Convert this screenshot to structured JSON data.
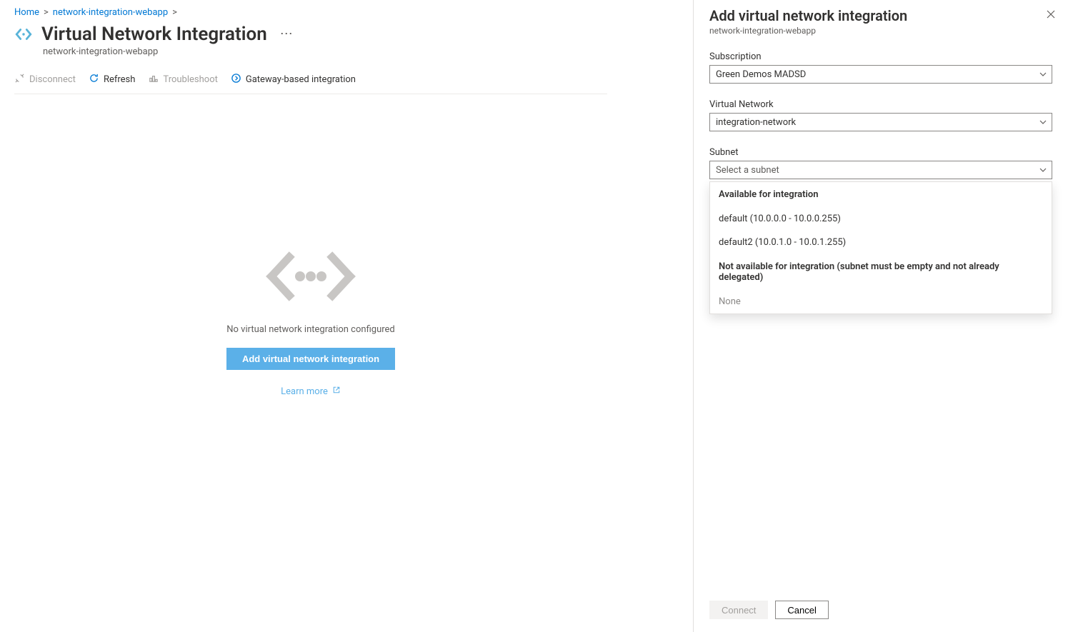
{
  "breadcrumb": {
    "home": "Home",
    "resource": "network-integration-webapp"
  },
  "header": {
    "title": "Virtual Network Integration",
    "subtitle": "network-integration-webapp"
  },
  "toolbar": {
    "disconnect": "Disconnect",
    "refresh": "Refresh",
    "troubleshoot": "Troubleshoot",
    "gateway": "Gateway-based integration"
  },
  "empty": {
    "message": "No virtual network integration configured",
    "button": "Add virtual network integration",
    "learn_more": "Learn more"
  },
  "panel": {
    "title": "Add virtual network integration",
    "subtitle": "network-integration-webapp",
    "subscription": {
      "label": "Subscription",
      "value": "Green Demos MADSD"
    },
    "vnet": {
      "label": "Virtual Network",
      "value": "integration-network"
    },
    "subnet": {
      "label": "Subnet",
      "placeholder": "Select a subnet",
      "available_header": "Available for integration",
      "options": [
        "default (10.0.0.0 - 10.0.0.255)",
        "default2 (10.0.1.0 - 10.0.1.255)"
      ],
      "unavailable_header": "Not available for integration (subnet must be empty and not already delegated)",
      "none_text": "None"
    },
    "connect": "Connect",
    "cancel": "Cancel"
  }
}
